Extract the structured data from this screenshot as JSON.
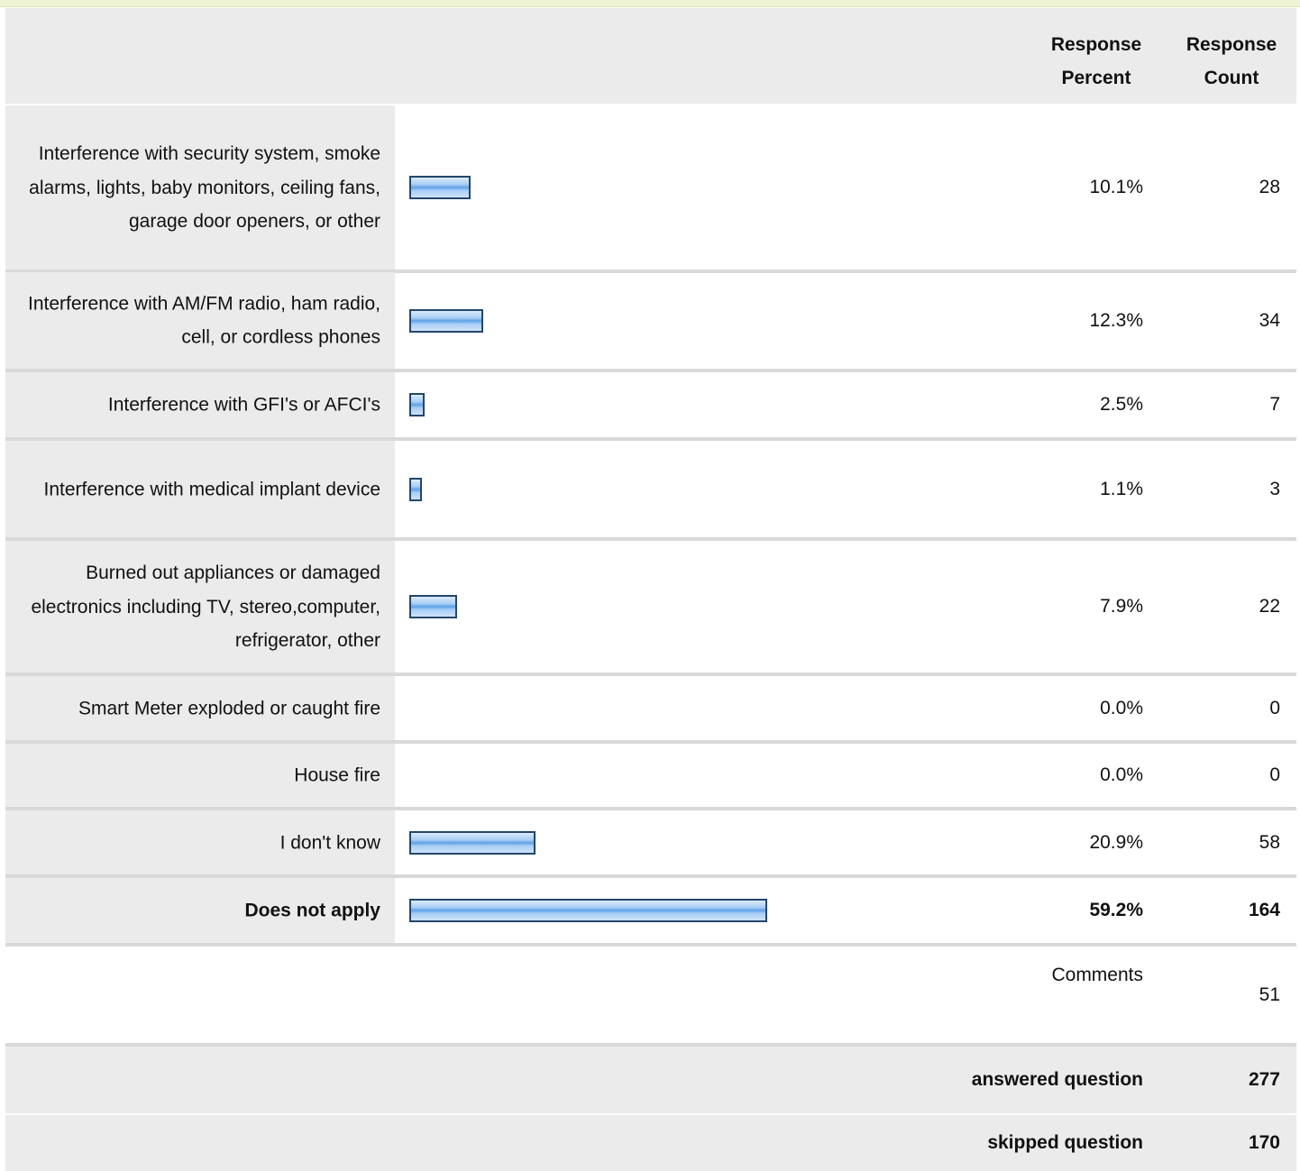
{
  "header": {
    "response_percent": "Response Percent",
    "response_count": "Response Count"
  },
  "chart_data": {
    "type": "bar",
    "orientation": "horizontal",
    "categories": [
      "Interference with security system, smoke alarms, lights, baby monitors, ceiling fans, garage door openers, or other",
      "Interference with AM/FM radio, ham radio, cell, or cordless phones",
      "Interference with GFI's or AFCI's",
      "Interference with medical implant device",
      "Burned out appliances or damaged electronics including TV, stereo,computer, refrigerator, other",
      "Smart Meter exploded or caught fire",
      "House fire",
      "I don't know",
      "Does not apply"
    ],
    "values": [
      10.1,
      12.3,
      2.5,
      1.1,
      7.9,
      0.0,
      0.0,
      20.9,
      59.2
    ],
    "percent_labels": [
      "10.1%",
      "12.3%",
      "2.5%",
      "1.1%",
      "7.9%",
      "0.0%",
      "0.0%",
      "20.9%",
      "59.2%"
    ],
    "counts": [
      "28",
      "34",
      "7",
      "3",
      "22",
      "0",
      "0",
      "58",
      "164"
    ],
    "bold_index": 8,
    "xlim": [
      0,
      100
    ],
    "bar_color": "#a8cdf5",
    "bar_border_color": "#24466b"
  },
  "comments": {
    "label": "Comments",
    "count": "51"
  },
  "summary": {
    "answered_label": "answered question",
    "answered_value": "277",
    "skipped_label": "skipped question",
    "skipped_value": "170"
  }
}
